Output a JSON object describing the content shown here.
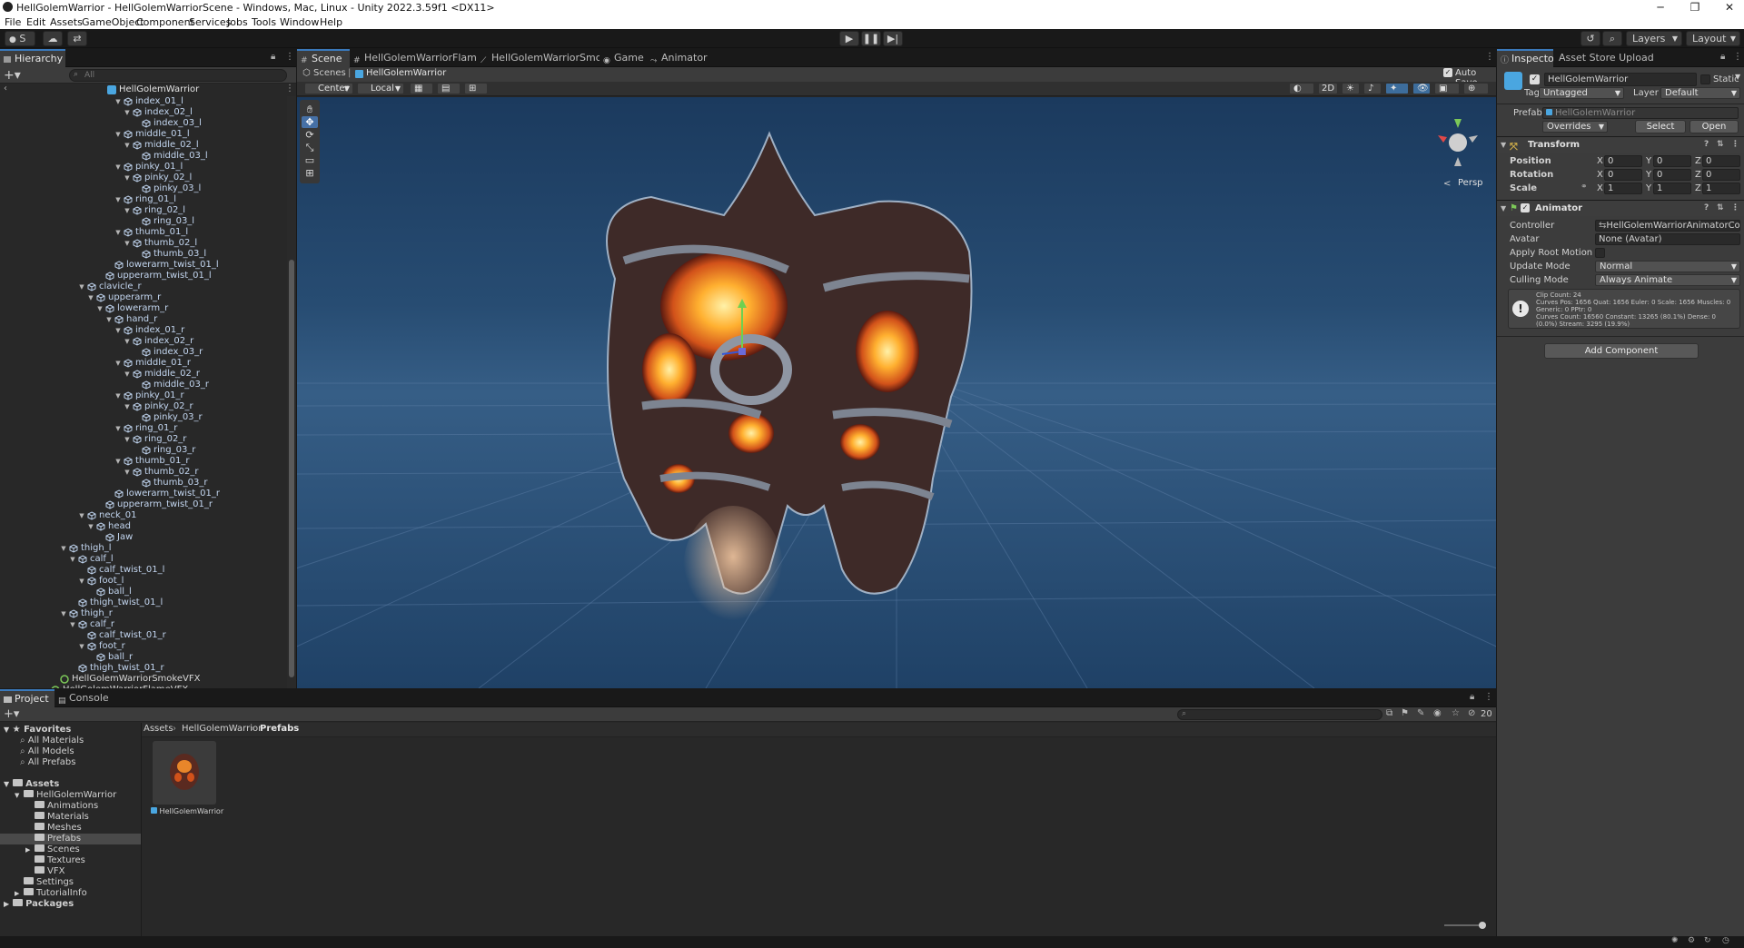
{
  "window": {
    "title": "HellGolemWarrior - HellGolemWarriorScene - Windows, Mac, Linux - Unity 2022.3.59f1 <DX11>"
  },
  "menu": [
    "File",
    "Edit",
    "Assets",
    "GameObject",
    "Component",
    "Services",
    "Jobs",
    "Tools",
    "Window",
    "Help"
  ],
  "toolbar": {
    "account": "S",
    "layers": "Layers",
    "layout": "Layout"
  },
  "hierarchy": {
    "tab": "Hierarchy",
    "search_placeholder": "All",
    "root": "HellGolemWarrior",
    "rows": [
      {
        "label": "index_01_l",
        "depth": 8,
        "exp": true
      },
      {
        "label": "index_02_l",
        "depth": 9,
        "exp": true
      },
      {
        "label": "index_03_l",
        "depth": 10,
        "exp": false
      },
      {
        "label": "middle_01_l",
        "depth": 8,
        "exp": true
      },
      {
        "label": "middle_02_l",
        "depth": 9,
        "exp": true
      },
      {
        "label": "middle_03_l",
        "depth": 10,
        "exp": false
      },
      {
        "label": "pinky_01_l",
        "depth": 8,
        "exp": true
      },
      {
        "label": "pinky_02_l",
        "depth": 9,
        "exp": true
      },
      {
        "label": "pinky_03_l",
        "depth": 10,
        "exp": false
      },
      {
        "label": "ring_01_l",
        "depth": 8,
        "exp": true
      },
      {
        "label": "ring_02_l",
        "depth": 9,
        "exp": true
      },
      {
        "label": "ring_03_l",
        "depth": 10,
        "exp": false
      },
      {
        "label": "thumb_01_l",
        "depth": 8,
        "exp": true
      },
      {
        "label": "thumb_02_l",
        "depth": 9,
        "exp": true
      },
      {
        "label": "thumb_03_l",
        "depth": 10,
        "exp": false
      },
      {
        "label": "lowerarm_twist_01_l",
        "depth": 7,
        "exp": false
      },
      {
        "label": "upperarm_twist_01_l",
        "depth": 6,
        "exp": false
      },
      {
        "label": "clavicle_r",
        "depth": 4,
        "exp": true
      },
      {
        "label": "upperarm_r",
        "depth": 5,
        "exp": true
      },
      {
        "label": "lowerarm_r",
        "depth": 6,
        "exp": true
      },
      {
        "label": "hand_r",
        "depth": 7,
        "exp": true
      },
      {
        "label": "index_01_r",
        "depth": 8,
        "exp": true
      },
      {
        "label": "index_02_r",
        "depth": 9,
        "exp": true
      },
      {
        "label": "index_03_r",
        "depth": 10,
        "exp": false
      },
      {
        "label": "middle_01_r",
        "depth": 8,
        "exp": true
      },
      {
        "label": "middle_02_r",
        "depth": 9,
        "exp": true
      },
      {
        "label": "middle_03_r",
        "depth": 10,
        "exp": false
      },
      {
        "label": "pinky_01_r",
        "depth": 8,
        "exp": true
      },
      {
        "label": "pinky_02_r",
        "depth": 9,
        "exp": true
      },
      {
        "label": "pinky_03_r",
        "depth": 10,
        "exp": false
      },
      {
        "label": "ring_01_r",
        "depth": 8,
        "exp": true
      },
      {
        "label": "ring_02_r",
        "depth": 9,
        "exp": true
      },
      {
        "label": "ring_03_r",
        "depth": 10,
        "exp": false
      },
      {
        "label": "thumb_01_r",
        "depth": 8,
        "exp": true
      },
      {
        "label": "thumb_02_r",
        "depth": 9,
        "exp": true
      },
      {
        "label": "thumb_03_r",
        "depth": 10,
        "exp": false
      },
      {
        "label": "lowerarm_twist_01_r",
        "depth": 7,
        "exp": false
      },
      {
        "label": "upperarm_twist_01_r",
        "depth": 6,
        "exp": false
      },
      {
        "label": "neck_01",
        "depth": 4,
        "exp": true
      },
      {
        "label": "head",
        "depth": 5,
        "exp": true
      },
      {
        "label": "Jaw",
        "depth": 6,
        "exp": false
      },
      {
        "label": "thigh_l",
        "depth": 2,
        "exp": true
      },
      {
        "label": "calf_l",
        "depth": 3,
        "exp": true
      },
      {
        "label": "calf_twist_01_l",
        "depth": 4,
        "exp": false
      },
      {
        "label": "foot_l",
        "depth": 4,
        "exp": true
      },
      {
        "label": "ball_l",
        "depth": 5,
        "exp": false
      },
      {
        "label": "thigh_twist_01_l",
        "depth": 3,
        "exp": false
      },
      {
        "label": "thigh_r",
        "depth": 2,
        "exp": true
      },
      {
        "label": "calf_r",
        "depth": 3,
        "exp": true
      },
      {
        "label": "calf_twist_01_r",
        "depth": 4,
        "exp": false
      },
      {
        "label": "foot_r",
        "depth": 4,
        "exp": true
      },
      {
        "label": "ball_r",
        "depth": 5,
        "exp": false
      },
      {
        "label": "thigh_twist_01_r",
        "depth": 3,
        "exp": false
      },
      {
        "label": "HellGolemWarriorSmokeVFX",
        "depth": 1,
        "exp": false,
        "vfx": true
      },
      {
        "label": "HellGolemWarriorFlameVFX",
        "depth": 0,
        "exp": false,
        "vfx": true
      }
    ]
  },
  "scene_tabs": [
    {
      "label": "Scene",
      "active": true
    },
    {
      "label": "HellGolemWarriorFlameVFX",
      "active": false
    },
    {
      "label": "HellGolemWarriorSmoke...",
      "active": false
    },
    {
      "label": "Game",
      "active": false
    },
    {
      "label": "Animator",
      "active": false
    }
  ],
  "scene": {
    "breadcrumb_root": "Scenes",
    "breadcrumb_item": "HellGolemWarrior",
    "auto_save": "Auto Save",
    "pivot": "Center",
    "space": "Local",
    "mode_2d": "2D",
    "persp": "Persp"
  },
  "inspector": {
    "tabs": [
      "Inspector",
      "Asset Store Uploader"
    ],
    "object_name": "HellGolemWarrior",
    "static_label": "Static",
    "tag_label": "Tag",
    "tag": "Untagged",
    "layer_label": "Layer",
    "layer": "Default",
    "prefab_label": "Prefab",
    "prefab_value": "HellGolemWarrior",
    "overrides": "Overrides",
    "select": "Select",
    "open": "Open",
    "transform": {
      "title": "Transform",
      "position": {
        "label": "Position",
        "x": "0",
        "y": "0",
        "z": "0"
      },
      "rotation": {
        "label": "Rotation",
        "x": "0",
        "y": "0",
        "z": "0"
      },
      "scale": {
        "label": "Scale",
        "x": "1",
        "y": "1",
        "z": "1"
      }
    },
    "animator": {
      "title": "Animator",
      "controller_label": "Controller",
      "controller": "HellGolemWarriorAnimatorContr",
      "avatar_label": "Avatar",
      "avatar": "None (Avatar)",
      "apply_root_label": "Apply Root Motion",
      "update_mode_label": "Update Mode",
      "update_mode": "Normal",
      "culling_label": "Culling Mode",
      "culling": "Always Animate",
      "info": [
        "Clip Count: 24",
        "Curves Pos: 1656 Quat: 1656 Euler: 0 Scale: 1656 Muscles: 0",
        "Generic: 0 PPtr: 0",
        "Curves Count: 16560 Constant: 13265 (80.1%) Dense: 0",
        "(0.0%) Stream: 3295 (19.9%)"
      ]
    },
    "add_component": "Add Component"
  },
  "project": {
    "tabs": [
      "Project",
      "Console"
    ],
    "count": "20",
    "favorites_label": "Favorites",
    "favorites": [
      "All Materials",
      "All Models",
      "All Prefabs"
    ],
    "assets_label": "Assets",
    "tree": [
      {
        "label": "HellGolemWarrior",
        "depth": 1,
        "exp": "open"
      },
      {
        "label": "Animations",
        "depth": 2,
        "exp": ""
      },
      {
        "label": "Materials",
        "depth": 2,
        "exp": ""
      },
      {
        "label": "Meshes",
        "depth": 2,
        "exp": ""
      },
      {
        "label": "Prefabs",
        "depth": 2,
        "exp": "",
        "selected": true
      },
      {
        "label": "Scenes",
        "depth": 2,
        "exp": "closed"
      },
      {
        "label": "Textures",
        "depth": 2,
        "exp": ""
      },
      {
        "label": "VFX",
        "depth": 2,
        "exp": ""
      },
      {
        "label": "Settings",
        "depth": 1,
        "exp": ""
      },
      {
        "label": "TutorialInfo",
        "depth": 1,
        "exp": "closed"
      }
    ],
    "packages_label": "Packages",
    "breadcrumb": [
      "Assets",
      "HellGolemWarrior",
      "Prefabs"
    ],
    "asset_name": "HellGolemWarrior"
  }
}
